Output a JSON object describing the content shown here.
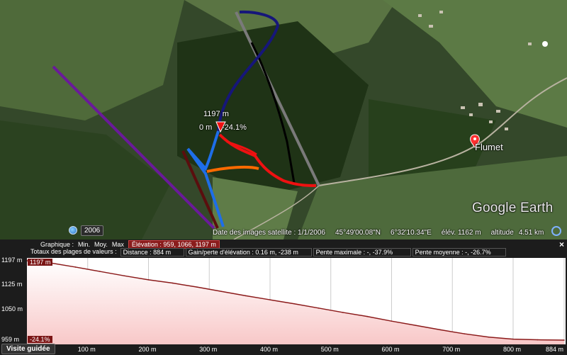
{
  "map": {
    "place_label": "Flumet",
    "logo_brand": "Google",
    "logo_product": "Earth",
    "year_badge": "2006",
    "pin_elevation": "1197 m",
    "pin_distance": "0 m",
    "pin_slope": "-24.1%",
    "status": {
      "imagery_date": "Date des images satellite : 1/1/2006",
      "latitude": "45°49'00.08\"N",
      "longitude": "6°32'10.34\"E",
      "elevation": "élév.  1162 m",
      "altitude_label": "altitude",
      "altitude_value": "4.51 km"
    }
  },
  "profile": {
    "close_symbol": "×",
    "graph_label": "Graphique :",
    "min_label": "Min.",
    "avg_label": "Moy.",
    "max_label": "Max",
    "elevation_range": "Élévation : 959, 1066, 1197 m",
    "totals_label": "Totaux des plages de valeurs :",
    "distance": "Distance : 884 m",
    "elevation_gain_loss": "Gain/perte d'élévation : 0.16 m, -238 m",
    "max_slope": "Pente maximale : -, -37.9%",
    "avg_slope": "Pente moyenne : -, -26.7%",
    "max_badge": "1197 m",
    "min_badge": "-24.1%",
    "tour_button": "Visite guidée"
  },
  "chart_data": {
    "type": "area",
    "x": [
      0,
      40,
      80,
      120,
      160,
      200,
      240,
      280,
      320,
      360,
      400,
      440,
      480,
      520,
      560,
      600,
      640,
      680,
      720,
      760,
      800,
      840,
      884
    ],
    "y": [
      1197,
      1190,
      1178,
      1165,
      1152,
      1140,
      1130,
      1118,
      1105,
      1092,
      1080,
      1068,
      1055,
      1042,
      1030,
      1016,
      1003,
      990,
      978,
      968,
      962,
      960,
      959
    ],
    "y_ticks": [
      "1197 m",
      "1125 m",
      "1050 m",
      "959 m"
    ],
    "y_tick_values": [
      1197,
      1125,
      1050,
      959
    ],
    "x_ticks": [
      "100 m",
      "200 m",
      "300 m",
      "400 m",
      "500 m",
      "600 m",
      "700 m",
      "800 m",
      "884 m"
    ],
    "x_tick_values": [
      100,
      200,
      300,
      400,
      500,
      600,
      700,
      800,
      884
    ],
    "xlim": [
      0,
      884
    ],
    "ylim": [
      959,
      1197
    ],
    "line_color": "#8b1a1a",
    "fill_color": "#f8c8c8",
    "grid": true
  }
}
